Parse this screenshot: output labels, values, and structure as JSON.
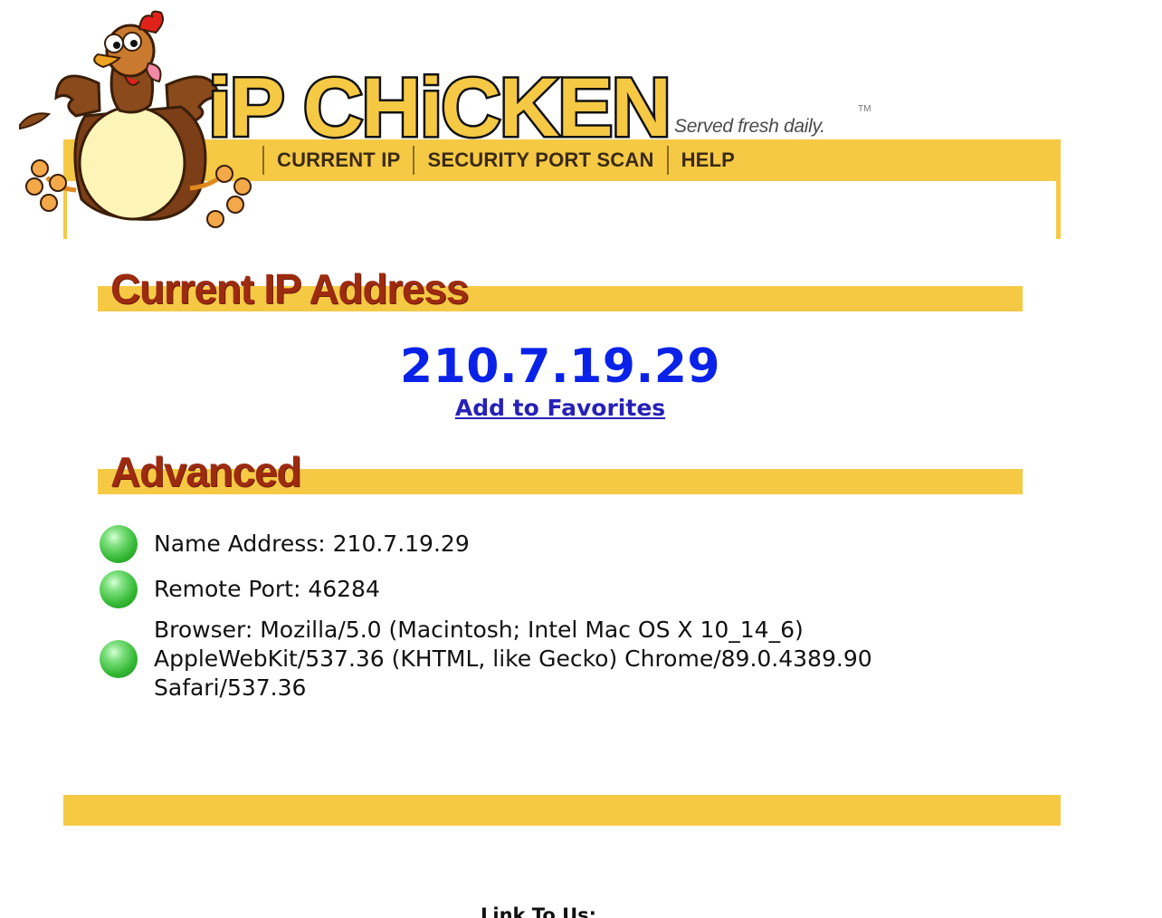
{
  "header": {
    "logo_text": "iP CHiCKEN",
    "tagline": "Served fresh daily.",
    "trademark": "TM",
    "nav": [
      {
        "label": "CURRENT IP"
      },
      {
        "label": "SECURITY PORT SCAN"
      },
      {
        "label": "HELP"
      }
    ]
  },
  "current_ip_section": {
    "title": "Current IP Address",
    "ip": "210.7.19.29",
    "favorites_link": "Add to Favorites"
  },
  "advanced_section": {
    "title": "Advanced",
    "items": [
      {
        "text": "Name Address: 210.7.19.29"
      },
      {
        "text": "Remote Port: 46284"
      },
      {
        "text": "Browser: Mozilla/5.0 (Macintosh; Intel Mac OS X 10_14_6) AppleWebKit/537.36 (KHTML, like Gecko) Chrome/89.0.4389.90 Safari/537.36"
      }
    ]
  },
  "footer": {
    "link_to_us": "Link To Us:"
  },
  "colors": {
    "band_yellow": "#f6c945",
    "heading_red": "#9c2b10",
    "ip_blue": "#0a22e8",
    "link_blue": "#2621b8",
    "bullet_green": "#34b934"
  },
  "icons": {
    "mascot": "chicken-mascot-icon",
    "bullet": "green-ball-icon"
  }
}
